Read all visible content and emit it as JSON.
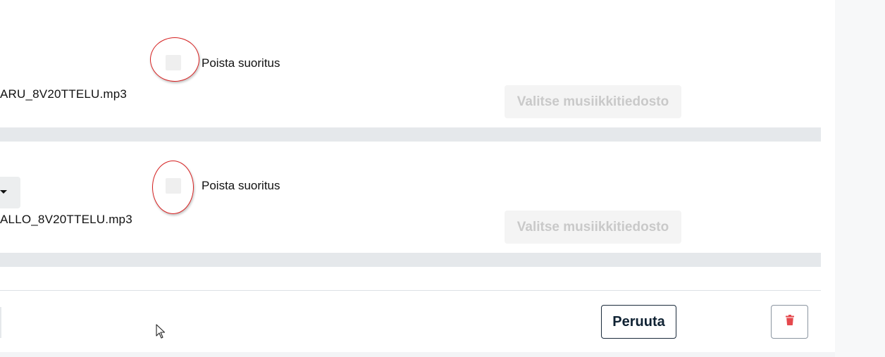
{
  "entries": [
    {
      "delete_label": "Poista suoritus",
      "filename": "ARU_8V20TTELU.mp3",
      "choose_file_label": "Valitse musiikkitiedosto"
    },
    {
      "delete_label": "Poista suoritus",
      "filename": "ALLO_8V20TTELU.mp3",
      "choose_file_label": "Valitse musiikkitiedosto"
    }
  ],
  "footer": {
    "cancel_label": "Peruuta",
    "delete_icon": "trash-icon"
  },
  "colors": {
    "ring": "#d62020",
    "trash": "#e5484d",
    "cancel_border": "#1b2b3b"
  }
}
